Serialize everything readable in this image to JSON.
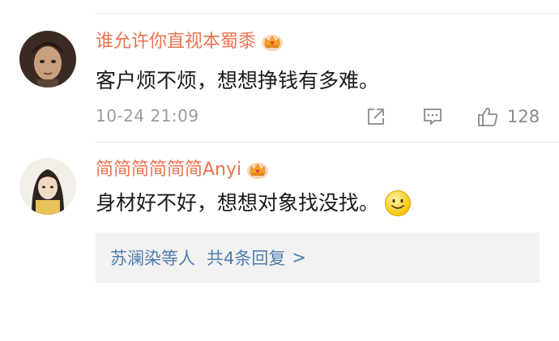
{
  "comments": [
    {
      "username": "谁允许你直视本蜀黍",
      "text": "客户烦不烦，想想挣钱有多难。",
      "timestamp": "10-24 21:09",
      "likes": "128",
      "badge_icon": "vip-crown-icon",
      "avatar_icon": "user-avatar"
    },
    {
      "username": "简简简简简简Anyi",
      "text": "身材好不好，想想对象找没找。",
      "emoji_icon": "smile-emoji-icon",
      "badge_icon": "vip-crown-icon",
      "avatar_icon": "user-avatar"
    }
  ],
  "replies": {
    "users": "苏澜染",
    "suffix": "等人",
    "count_text": "共4条回复",
    "chevron": ">"
  },
  "colors": {
    "username": "#eb7350",
    "link": "#507daf",
    "meta": "#9b9b9b",
    "reply_bg": "#f2f2f2"
  }
}
